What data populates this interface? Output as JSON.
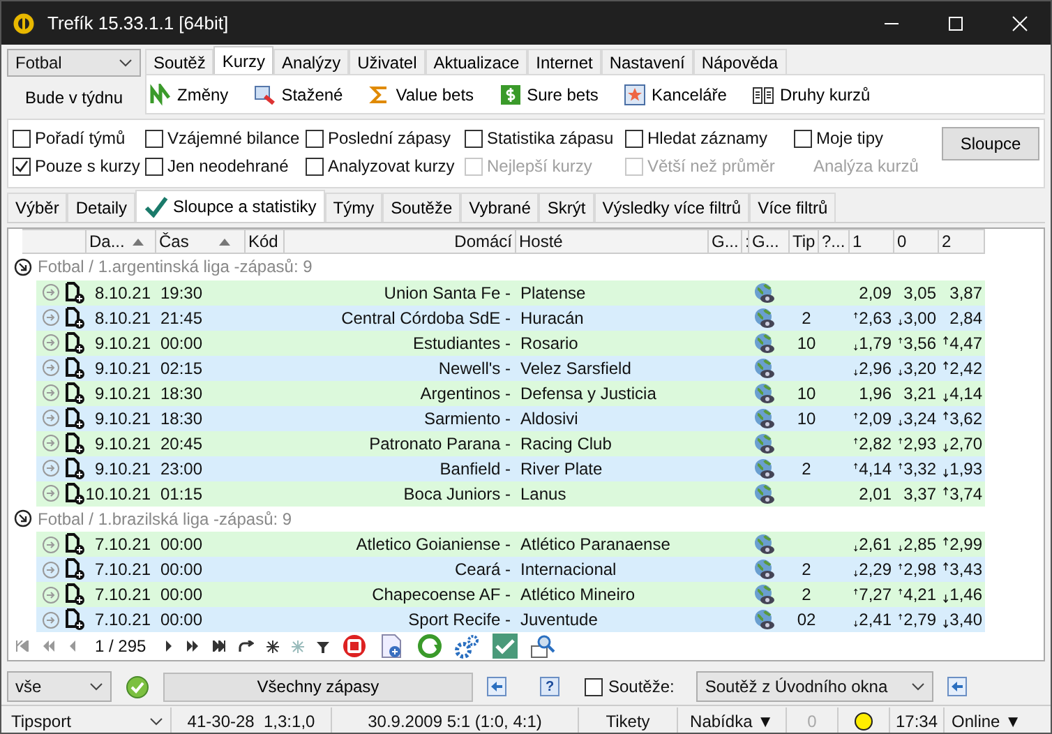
{
  "window": {
    "title": "Trefík 15.33.1.1 [64bit]"
  },
  "sport_select": "Fotbal",
  "week_button": "Bude v týdnu",
  "menu_tabs": [
    {
      "label": "Soutěž",
      "selected": false
    },
    {
      "label": "Kurzy",
      "selected": true
    },
    {
      "label": "Analýzy",
      "selected": false
    },
    {
      "label": "Uživatel",
      "selected": false
    },
    {
      "label": "Aktualizace",
      "selected": false
    },
    {
      "label": "Internet",
      "selected": false
    },
    {
      "label": "Nastavení",
      "selected": false
    },
    {
      "label": "Nápověda",
      "selected": false
    }
  ],
  "toolbar": [
    "Změny",
    "Stažené",
    "Value bets",
    "Sure bets",
    "Kanceláře",
    "Druhy kurzů"
  ],
  "options": [
    {
      "kind": "checkbox",
      "label": "Pořadí týmů",
      "checked": false,
      "disabled": false
    },
    {
      "kind": "checkbox",
      "label": "Vzájemné bilance",
      "checked": false,
      "disabled": false
    },
    {
      "kind": "checkbox",
      "label": "Poslední zápasy",
      "checked": false,
      "disabled": false
    },
    {
      "kind": "checkbox",
      "label": "Statistika zápasu",
      "checked": false,
      "disabled": false
    },
    {
      "kind": "checkbox",
      "label": "Hledat záznamy",
      "checked": false,
      "disabled": false
    },
    {
      "kind": "checkbox",
      "label": "Moje tipy",
      "checked": false,
      "disabled": false
    },
    {
      "kind": "checkbox",
      "label": "Pouze s kurzy",
      "checked": true,
      "disabled": false
    },
    {
      "kind": "checkbox",
      "label": "Jen neodehrané",
      "checked": false,
      "disabled": false
    },
    {
      "kind": "checkbox",
      "label": "Analyzovat kurzy",
      "checked": false,
      "disabled": false
    },
    {
      "kind": "checkbox",
      "label": "Nejlepší kurzy",
      "checked": false,
      "disabled": true
    },
    {
      "kind": "checkbox",
      "label": "Větší než průměr",
      "checked": false,
      "disabled": true
    },
    {
      "kind": "label",
      "label": "Analýza kurzů",
      "disabled": true
    }
  ],
  "columns_button": "Sloupce",
  "view_tabs": [
    {
      "label": "Výběr",
      "selected": false
    },
    {
      "label": "Detaily",
      "selected": false
    },
    {
      "label": "Sloupce a statistiky",
      "selected": true
    },
    {
      "label": "Týmy",
      "selected": false
    },
    {
      "label": "Soutěže",
      "selected": false
    },
    {
      "label": "Vybrané",
      "selected": false
    },
    {
      "label": "Skrýt",
      "selected": false
    },
    {
      "label": "Výsledky více filtrů",
      "selected": false
    },
    {
      "label": "Více filtrů",
      "selected": false
    }
  ],
  "table": {
    "columns": [
      {
        "label": "Da...",
        "sorted": true
      },
      {
        "label": "Čas",
        "sorted": true
      },
      {
        "label": "Kód",
        "sorted": false
      },
      {
        "label": "Domácí",
        "sorted": false
      },
      {
        "label": "Hosté",
        "sorted": false
      },
      {
        "label": "G...",
        "sorted": false
      },
      {
        "label": ":",
        "sorted": false
      },
      {
        "label": "G...",
        "sorted": false
      },
      {
        "label": "Tip",
        "sorted": false
      },
      {
        "label": "?...",
        "sorted": false
      },
      {
        "label": "1",
        "sorted": false
      },
      {
        "label": "0",
        "sorted": false
      },
      {
        "label": "2",
        "sorted": false
      }
    ],
    "groups": [
      {
        "title": "Fotbal / 1.argentinská liga -zápasů: 9",
        "rows": [
          {
            "date": "8.10.21",
            "time": "19:30",
            "home": "Union Santa Fe -",
            "away": "Platense",
            "odds": [
              {
                "value": "2,09",
                "up": false,
                "down": false
              },
              {
                "value": "3,05",
                "up": false,
                "down": false
              },
              {
                "value": "3,87",
                "up": false,
                "down": false
              }
            ]
          },
          {
            "date": "8.10.21",
            "time": "21:45",
            "home": "Central Córdoba SdE -",
            "away": "Huracán",
            "tip": "2",
            "odds": [
              {
                "value": "2,63",
                "up": true,
                "down": false
              },
              {
                "value": "3,00",
                "up": false,
                "down": true
              },
              {
                "value": "2,84",
                "up": false,
                "down": false
              }
            ]
          },
          {
            "date": "9.10.21",
            "time": "00:00",
            "home": "Estudiantes -",
            "away": "Rosario",
            "tip": "10",
            "odds": [
              {
                "value": "1,79",
                "up": false,
                "down": true
              },
              {
                "value": "3,56",
                "up": true,
                "down": false
              },
              {
                "value": "4,47",
                "up": true,
                "down": false
              }
            ]
          },
          {
            "date": "9.10.21",
            "time": "02:15",
            "home": "Newell's -",
            "away": "Velez Sarsfield",
            "odds": [
              {
                "value": "2,96",
                "up": false,
                "down": true
              },
              {
                "value": "3,20",
                "up": false,
                "down": true
              },
              {
                "value": "2,42",
                "up": true,
                "down": false
              }
            ]
          },
          {
            "date": "9.10.21",
            "time": "18:30",
            "home": "Argentinos -",
            "away": "Defensa y Justicia",
            "tip": "10",
            "odds": [
              {
                "value": "1,96",
                "up": false,
                "down": false
              },
              {
                "value": "3,21",
                "up": false,
                "down": false
              },
              {
                "value": "4,14",
                "up": false,
                "down": true
              }
            ]
          },
          {
            "date": "9.10.21",
            "time": "18:30",
            "home": "Sarmiento -",
            "away": "Aldosivi",
            "tip": "10",
            "odds": [
              {
                "value": "2,09",
                "up": true,
                "down": false
              },
              {
                "value": "3,24",
                "up": false,
                "down": true
              },
              {
                "value": "3,62",
                "up": true,
                "down": false
              }
            ]
          },
          {
            "date": "9.10.21",
            "time": "20:45",
            "home": "Patronato Parana -",
            "away": "Racing Club",
            "odds": [
              {
                "value": "2,82",
                "up": true,
                "down": false
              },
              {
                "value": "2,93",
                "up": true,
                "down": false
              },
              {
                "value": "2,70",
                "up": false,
                "down": true
              }
            ]
          },
          {
            "date": "9.10.21",
            "time": "23:00",
            "home": "Banfield -",
            "away": "River Plate",
            "tip": "2",
            "odds": [
              {
                "value": "4,14",
                "up": true,
                "down": false
              },
              {
                "value": "3,32",
                "up": true,
                "down": false
              },
              {
                "value": "1,93",
                "up": false,
                "down": true
              }
            ]
          },
          {
            "date": "10.10.21",
            "time": "01:15",
            "home": "Boca Juniors -",
            "away": "Lanus",
            "odds": [
              {
                "value": "2,01",
                "up": false,
                "down": false
              },
              {
                "value": "3,37",
                "up": false,
                "down": false
              },
              {
                "value": "3,74",
                "up": true,
                "down": false
              }
            ]
          }
        ]
      },
      {
        "title": "Fotbal / 1.brazilská liga -zápasů: 9",
        "rows": [
          {
            "date": "7.10.21",
            "time": "00:00",
            "home": "Atletico Goianiense -",
            "away": "Atlético Paranaense",
            "odds": [
              {
                "value": "2,61",
                "up": false,
                "down": true
              },
              {
                "value": "2,85",
                "up": false,
                "down": true
              },
              {
                "value": "2,99",
                "up": true,
                "down": false
              }
            ]
          },
          {
            "date": "7.10.21",
            "time": "00:00",
            "home": "Ceará -",
            "away": "Internacional",
            "tip": "2",
            "odds": [
              {
                "value": "2,29",
                "up": false,
                "down": true
              },
              {
                "value": "2,98",
                "up": true,
                "down": false
              },
              {
                "value": "3,43",
                "up": true,
                "down": false
              }
            ]
          },
          {
            "date": "7.10.21",
            "time": "00:00",
            "home": "Chapecoense AF -",
            "away": "Atlético Mineiro",
            "tip": "2",
            "odds": [
              {
                "value": "7,27",
                "up": true,
                "down": false
              },
              {
                "value": "4,21",
                "up": true,
                "down": false
              },
              {
                "value": "1,46",
                "up": false,
                "down": true
              }
            ]
          },
          {
            "date": "7.10.21",
            "time": "00:00",
            "home": "Sport Recife -",
            "away": "Juventude",
            "tip": "02",
            "odds": [
              {
                "value": "2,41",
                "up": false,
                "down": true
              },
              {
                "value": "2,79",
                "up": true,
                "down": false
              },
              {
                "value": "3,40",
                "up": false,
                "down": true
              }
            ]
          }
        ]
      }
    ]
  },
  "pager": "1 / 295",
  "filter_bar": {
    "select": "vše",
    "button": "Všechny zápasy",
    "help": "?",
    "competitions": {
      "label": "Soutěže:",
      "checked": false
    },
    "competition_select": "Soutěž z Úvodního okna"
  },
  "status_bar": {
    "bookmaker": "Tipsport",
    "stats": "41-30-28  1,3:1,0",
    "last_result": "30.9.2009 5:1 (1:0, 4:1)",
    "tickets": "Tikety",
    "offer": "Nabídka ▼",
    "counter": "0",
    "time": "17:34",
    "online": "Online ▼"
  }
}
